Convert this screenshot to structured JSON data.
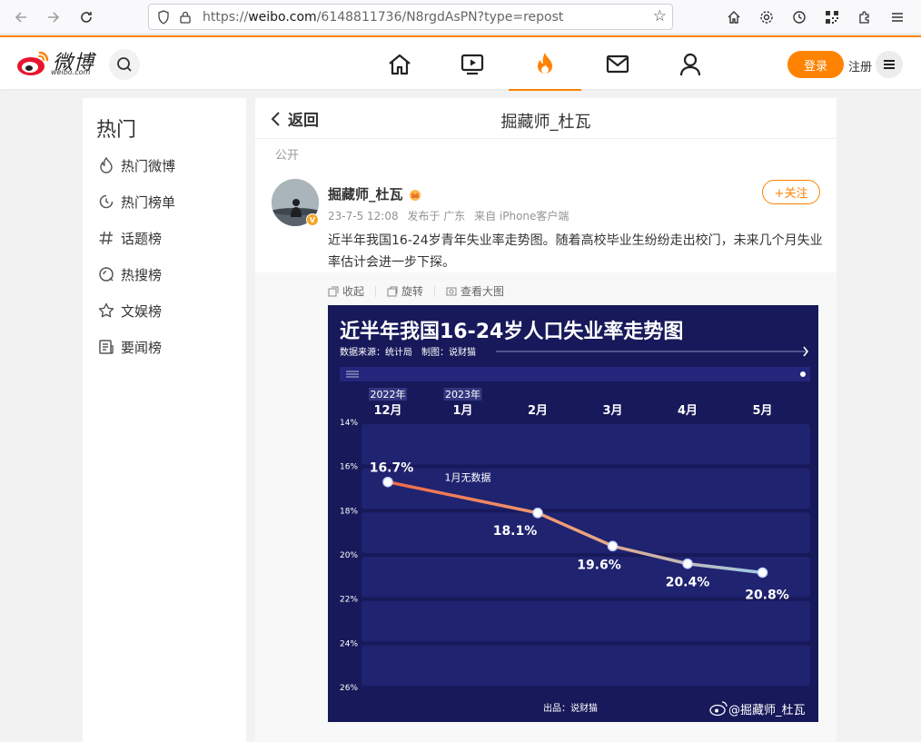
{
  "browser": {
    "url_prefix": "https://",
    "url_domain": "weibo.com",
    "url_path": "/6148811736/N8rgdAsPN?type=repost"
  },
  "header": {
    "logo_text": "微博",
    "logo_sub": "weibo.com",
    "login_label": "登录",
    "register_label": "注册",
    "accent": "#ff8200"
  },
  "sidebar": {
    "title": "热门",
    "items": [
      {
        "label": "热门微博",
        "icon": "flame-icon"
      },
      {
        "label": "热门榜单",
        "icon": "clock-icon"
      },
      {
        "label": "话题榜",
        "icon": "hashtag-icon"
      },
      {
        "label": "热搜榜",
        "icon": "search-circle-icon"
      },
      {
        "label": "文娱榜",
        "icon": "star-icon"
      },
      {
        "label": "要闻榜",
        "icon": "news-icon"
      }
    ]
  },
  "post": {
    "back_label": "返回",
    "page_title": "掘藏师_杜瓦",
    "visibility": "公开",
    "author": "掘藏师_杜瓦",
    "time": "23-7-5 12:08",
    "location": "发布于 广东",
    "source": "来自 iPhone客户端",
    "follow_label": "+关注",
    "text": "近半年我国16-24岁青年失业率走势图。随着高校毕业生纷纷走出校门，未来几个月失业率估计会进一步下探。",
    "tools": {
      "collapse": "收起",
      "rotate": "旋转",
      "view_large": "查看大图"
    }
  },
  "chart_data": {
    "type": "line",
    "title": "近半年我国16-24岁人口失业率走势图",
    "subtitle": "数据来源：统计局　制图：说财猫",
    "year_labels": [
      {
        "at": "12月",
        "text": "2022年"
      },
      {
        "at": "1月",
        "text": "2023年"
      }
    ],
    "categories": [
      "12月",
      "1月",
      "2月",
      "3月",
      "4月",
      "5月"
    ],
    "series": [
      {
        "values": [
          16.7,
          null,
          18.1,
          19.6,
          20.4,
          20.8
        ]
      }
    ],
    "value_labels": [
      "16.7%",
      "",
      "18.1%",
      "19.6%",
      "20.4%",
      "20.8%"
    ],
    "annotation": {
      "at": "1月",
      "text": "1月无数据"
    },
    "y_ticks": [
      "14%",
      "16%",
      "18%",
      "20%",
      "22%",
      "24%",
      "26%"
    ],
    "y_tick_values": [
      14,
      16,
      18,
      20,
      22,
      24,
      26
    ],
    "ylim": [
      14,
      26
    ],
    "y_inverted": true,
    "footer": "出品：说财猫",
    "watermark": "@掘藏师_杜瓦",
    "colors": {
      "background": "#17195a",
      "line_start": "#ef6a4a",
      "line_end": "#9ecbe6"
    }
  }
}
